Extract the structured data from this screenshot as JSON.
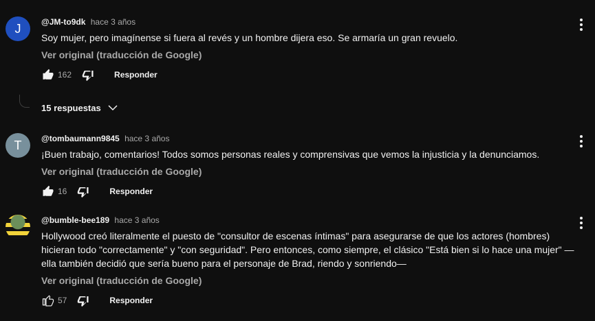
{
  "comments": [
    {
      "avatar_letter": "J",
      "avatar_color": "#1f4fbf",
      "author": "@JM-to9dk",
      "time": "hace 3 años",
      "text": "Soy mujer, pero imagínense si fuera al revés y un hombre dijera eso. Se armaría un gran revuelo.",
      "translate_label": "Ver original (traducción de Google)",
      "likes": "162",
      "reply_label": "Responder",
      "liked": true,
      "replies_label": "15 respuestas"
    },
    {
      "avatar_letter": "T",
      "avatar_color": "#78909c",
      "author": "@tombaumann9845",
      "time": "hace 3 años",
      "text": "¡Buen trabajo, comentarios! Todos somos personas reales y comprensivas que vemos la injusticia y la denunciamos.",
      "translate_label": "Ver original (traducción de Google)",
      "likes": "16",
      "reply_label": "Responder",
      "liked": true
    },
    {
      "avatar_letter": "",
      "avatar_color": "#f2d33a",
      "author": "@bumble-bee189",
      "time": "hace 3 años",
      "text": "Hollywood creó literalmente el puesto de \"consultor de escenas íntimas\" para asegurarse de que los actores (hombres) hicieran todo \"correctamente\" y \"con seguridad\". Pero entonces, como siempre, el clásico \"Está bien si lo hace una mujer\" —ella también decidió que sería bueno para el personaje de Brad, riendo y sonriendo—",
      "translate_label": "Ver original (traducción de Google)",
      "likes": "57",
      "reply_label": "Responder",
      "liked": false
    }
  ]
}
